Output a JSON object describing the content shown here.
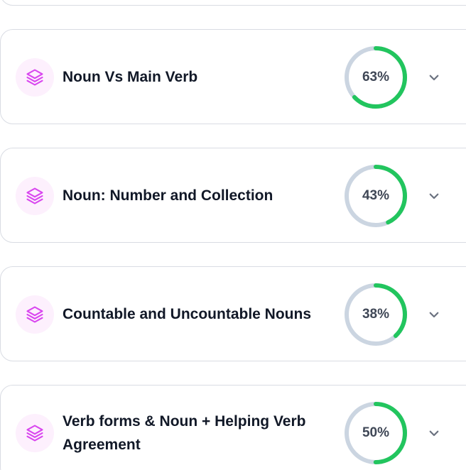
{
  "colors": {
    "icon_accent": "#d946ef",
    "icon_bg": "#fdf0fd",
    "progress_fill": "#22c55e",
    "progress_track": "#cbd5e1",
    "chevron": "#6b7280"
  },
  "topics": [
    {
      "title": "Noun Vs Main Verb",
      "progress_label": "63%",
      "progress": 63,
      "icon": "layers-icon",
      "expand_icon": "chevron-down-icon"
    },
    {
      "title": "Noun: Number and Collection",
      "progress_label": "43%",
      "progress": 43,
      "icon": "layers-icon",
      "expand_icon": "chevron-down-icon"
    },
    {
      "title": "Countable and Uncountable Nouns",
      "progress_label": "38%",
      "progress": 38,
      "icon": "layers-icon",
      "expand_icon": "chevron-down-icon"
    },
    {
      "title": "Verb forms & Noun + Helping Verb Agreement",
      "progress_label": "50%",
      "progress": 50,
      "icon": "layers-icon",
      "expand_icon": "chevron-down-icon"
    }
  ]
}
